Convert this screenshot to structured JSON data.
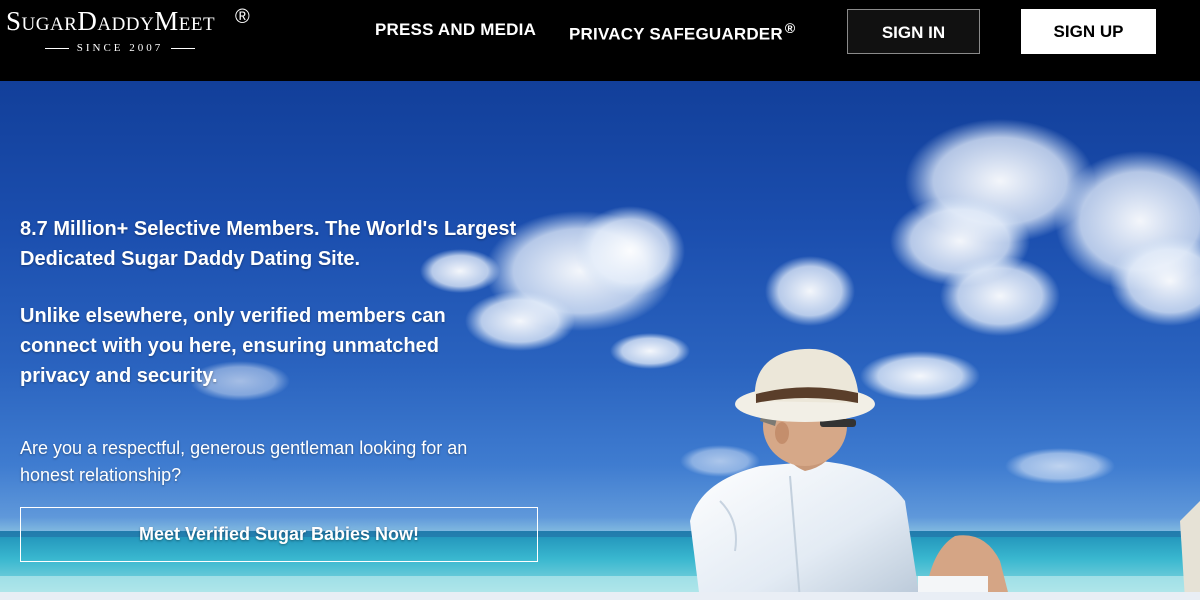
{
  "brand": {
    "logo_text": "SugarDaddyMeet",
    "registered_mark": "®",
    "since": "SINCE 2007"
  },
  "nav": {
    "press_label": "PRESS AND MEDIA",
    "privacy_label": "PRIVACY SAFEGUARDER",
    "privacy_mark": "®",
    "signin_label": "SIGN IN",
    "signup_label": "SIGN UP"
  },
  "hero": {
    "headline": "8.7 Million+ Selective Members. The World's Largest Dedicated Sugar Daddy Dating Site.",
    "subline": "Unlike elsewhere, only verified members can connect with you here, ensuring unmatched privacy and security.",
    "question": "Are you a respectful, generous gentleman looking for an honest relationship?",
    "cta_label": "Meet Verified Sugar Babies Now!"
  },
  "colors": {
    "header_bg": "#000000",
    "sky": "#1b4eae",
    "sea": "#2aa7c3",
    "signup_bg": "#ffffff"
  },
  "icons": {
    "hero_image": "man-in-hat-at-beach"
  }
}
